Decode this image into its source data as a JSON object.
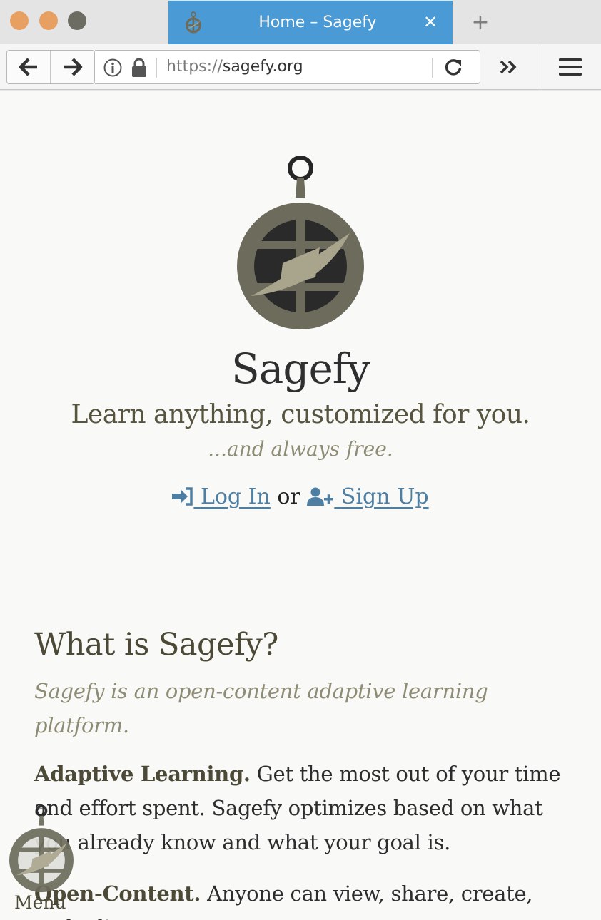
{
  "browser": {
    "tab_title": "Home – Sagefy",
    "tab_close": "✕",
    "new_tab": "+",
    "url_scheme": "https://",
    "url_host": "sagefy.org"
  },
  "hero": {
    "title": "Sagefy",
    "tagline": "Learn anything, customized for you.",
    "subtagline": "...and always free.",
    "login_label": "Log In",
    "or_text": "or",
    "signup_label": "Sign Up"
  },
  "about": {
    "heading": "What is Sagefy?",
    "lead": "Sagefy is an open-content adaptive learning platform.",
    "adaptive_title": "Adaptive Learning.",
    "adaptive_text": "Get the most out of your time and effort spent. Sagefy optimizes based on what you already know and what your goal is.",
    "open_title": "Open-Content.",
    "open_text": "Anyone can view, share, create, and edit content."
  },
  "menu": {
    "label": "Menu"
  },
  "colors": {
    "tab_active": "#4a9ad6",
    "logo": "#6d6c5c",
    "link": "#4e7fa3",
    "heading": "#4c4a36"
  },
  "icons": [
    "sagefy-logo-icon",
    "back-arrow-icon",
    "forward-arrow-icon",
    "info-icon",
    "lock-icon",
    "reload-icon",
    "overflow-chevrons-icon",
    "hamburger-menu-icon",
    "log-in-icon",
    "add-user-icon"
  ]
}
